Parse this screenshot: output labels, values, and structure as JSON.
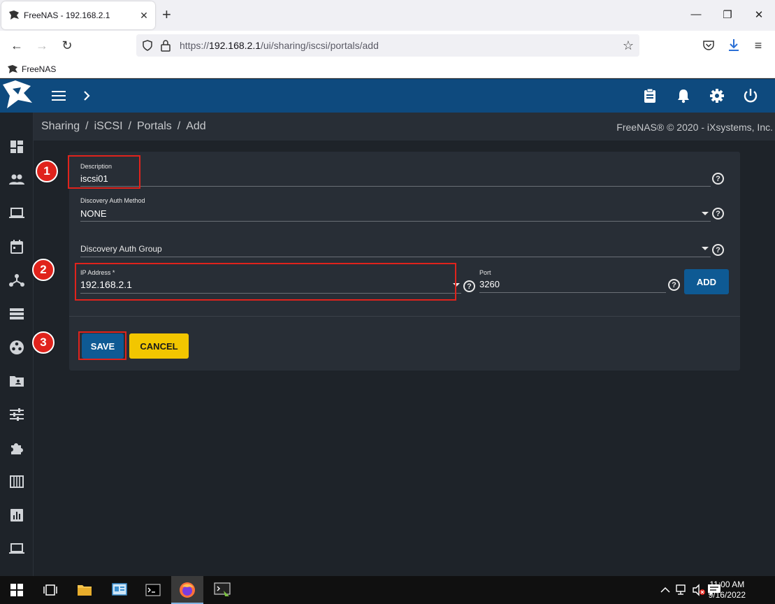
{
  "browser": {
    "tab_title": "FreeNAS - 192.168.2.1",
    "url_scheme": "https://",
    "url_host": "192.168.2.1",
    "url_path": "/ui/sharing/iscsi/portals/add",
    "bookmark_label": "FreeNAS"
  },
  "breadcrumb": {
    "items": [
      "Sharing",
      "iSCSI",
      "Portals",
      "Add"
    ],
    "separator": "/"
  },
  "copyright": "FreeNAS® © 2020 - iXsystems, Inc.",
  "form": {
    "description_label": "Description",
    "description_value": "iscsi01",
    "discovery_auth_method_label": "Discovery Auth Method",
    "discovery_auth_method_value": "NONE",
    "discovery_auth_group_label": "Discovery Auth Group",
    "ip_address_label": "IP Address *",
    "ip_address_value": "192.168.2.1",
    "port_label": "Port",
    "port_value": "3260",
    "add_label": "ADD",
    "save_label": "SAVE",
    "cancel_label": "CANCEL"
  },
  "annotations": {
    "marker_1": "1",
    "marker_2": "2",
    "marker_3": "3",
    "color": "#e0231c"
  },
  "taskbar": {
    "time": "11:00 AM",
    "date": "9/16/2022"
  },
  "colors": {
    "header": "#0e4a7e",
    "background": "#1e2329",
    "card": "#282e36",
    "primary_button": "#0e5a94",
    "cancel_button": "#f2c600"
  },
  "icons": {
    "sidebar": [
      "dashboard-icon",
      "accounts-icon",
      "system-icon",
      "tasks-icon",
      "network-icon",
      "storage-icon",
      "directory-services-icon",
      "sharing-icon",
      "services-icon",
      "plugins-icon",
      "jails-icon",
      "reporting-icon",
      "virtual-machines-icon"
    ],
    "header": [
      "menu-icon",
      "chevron-right-icon",
      "clipboard-icon",
      "bell-icon",
      "gear-icon",
      "power-icon"
    ]
  }
}
